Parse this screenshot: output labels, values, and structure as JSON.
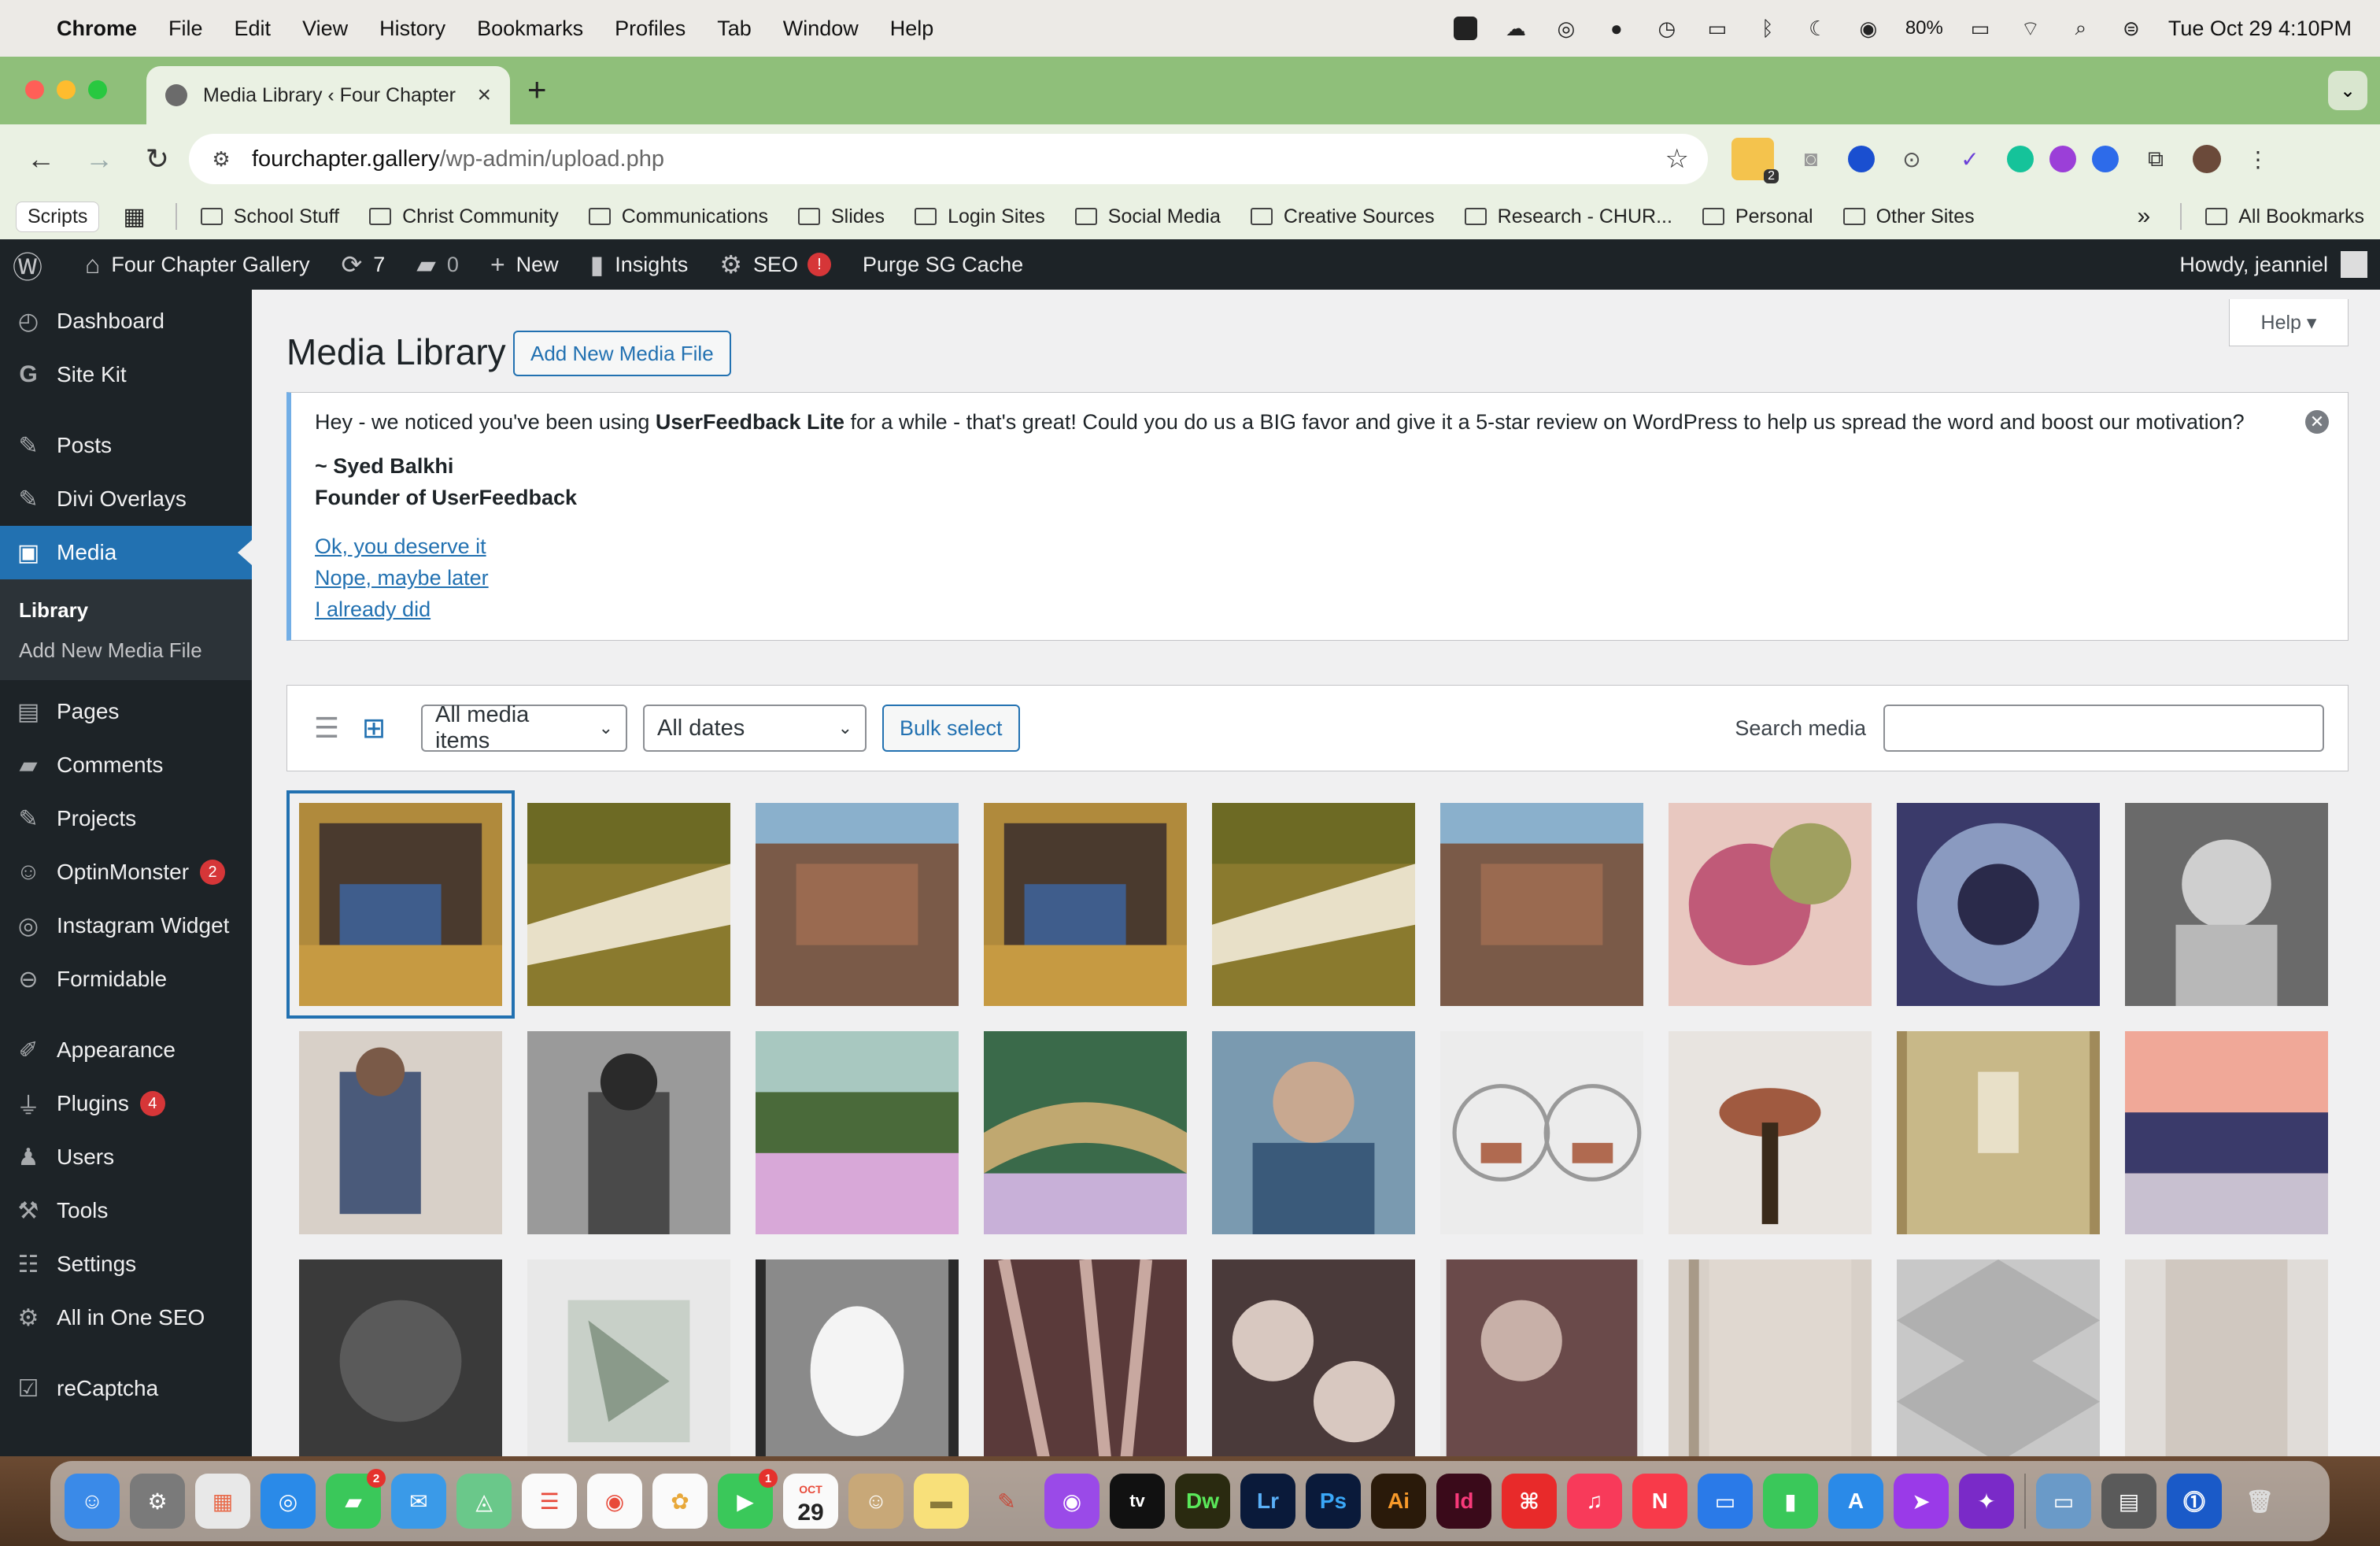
{
  "menubar": {
    "app": "Chrome",
    "items": [
      "File",
      "Edit",
      "View",
      "History",
      "Bookmarks",
      "Profiles",
      "Tab",
      "Window",
      "Help"
    ],
    "battery": "80%",
    "datetime": "Tue Oct 29  4:10PM"
  },
  "browser": {
    "tab_title": "Media Library ‹ Four Chapter",
    "url_host": "fourchapter.gallery",
    "url_path": "/wp-admin/upload.php",
    "extension_badge": "2"
  },
  "bookmarks": {
    "scripts": "Scripts",
    "folders": [
      "School Stuff",
      "Christ Community",
      "Communications",
      "Slides",
      "Login Sites",
      "Social Media",
      "Creative Sources",
      "Research - CHUR...",
      "Personal",
      "Other Sites"
    ],
    "overflow": "»",
    "all": "All Bookmarks"
  },
  "adminbar": {
    "site": "Four Chapter Gallery",
    "updates": "7",
    "comments": "0",
    "new": "New",
    "insights": "Insights",
    "seo": "SEO",
    "seo_badge": "!",
    "purge": "Purge SG Cache",
    "howdy": "Howdy, jeanniel"
  },
  "sidebar": {
    "dashboard": "Dashboard",
    "sitekit": "Site Kit",
    "posts": "Posts",
    "divi": "Divi Overlays",
    "media": "Media",
    "library": "Library",
    "add_new": "Add New Media File",
    "pages": "Pages",
    "comments": "Comments",
    "projects": "Projects",
    "optinmonster": "OptinMonster",
    "optinmonster_badge": "2",
    "instagram": "Instagram Widget",
    "formidable": "Formidable",
    "appearance": "Appearance",
    "plugins": "Plugins",
    "plugins_badge": "4",
    "users": "Users",
    "tools": "Tools",
    "settings": "Settings",
    "aioseo": "All in One SEO",
    "recaptcha": "reCaptcha"
  },
  "main": {
    "help": "Help ▾",
    "title": "Media Library",
    "add_new": "Add New Media File",
    "notice": {
      "text_before": "Hey - we noticed you've been using ",
      "text_bold": "UserFeedback Lite",
      "text_after": " for a while - that's great! Could you do us a BIG favor and give it a 5-star review on WordPress to help us spread the word and boost our motivation?",
      "sig_name": "~ Syed Balkhi",
      "sig_role": "Founder of UserFeedback",
      "link1": "Ok, you deserve it",
      "link2": "Nope, maybe later",
      "link3": "I already did",
      "dismiss": "✕"
    },
    "filter": {
      "media_type": "All media items",
      "dates": "All dates",
      "bulk": "Bulk select",
      "search_label": "Search media"
    }
  },
  "dock": {
    "messages_badge": "2",
    "facetime_badge": "1",
    "calendar_month": "OCT",
    "calendar_day": "29",
    "apps": [
      "Dw",
      "Lr",
      "Ps",
      "Ai",
      "Id"
    ]
  },
  "colors": {
    "wp_dark": "#1d2327",
    "wp_blue": "#2271b1",
    "chrome_green": "#8fbf7a"
  }
}
